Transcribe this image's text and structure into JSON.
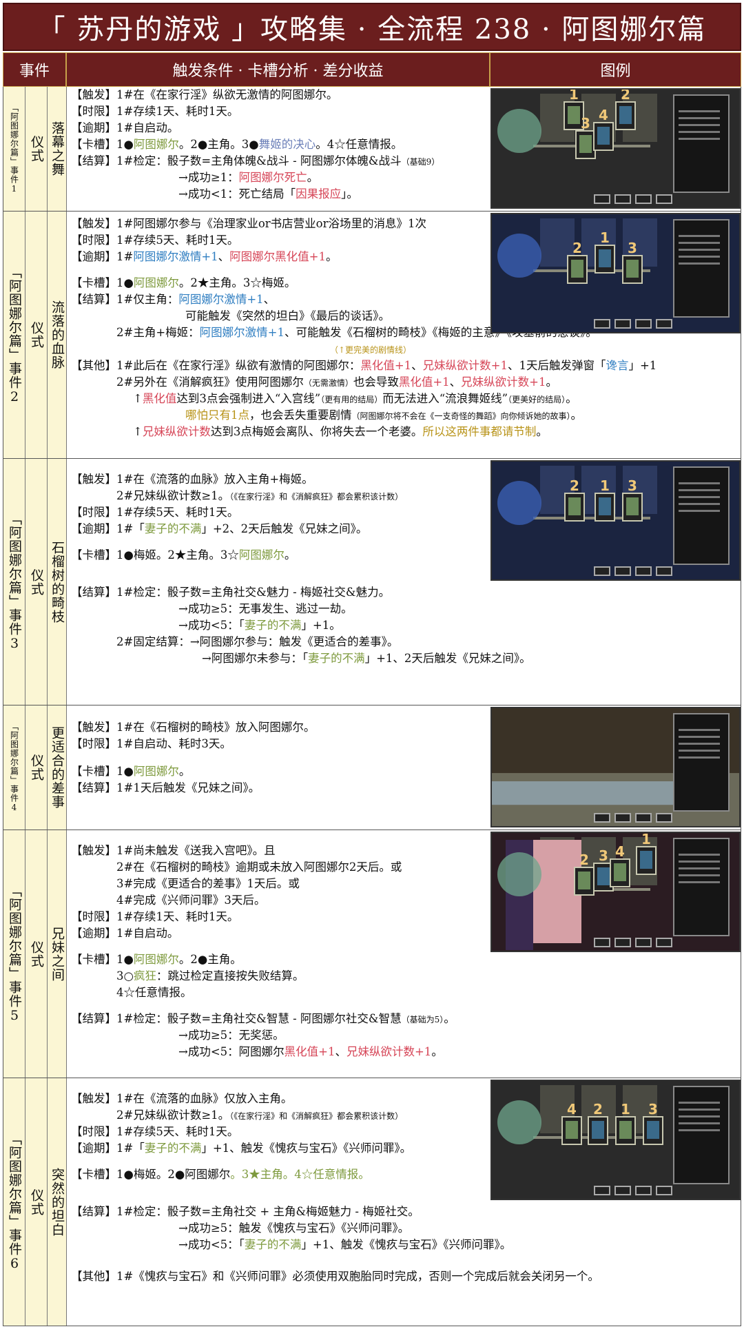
{
  "title": "「 苏丹的游戏 」攻略集 · 全流程 238 · 阿图娜尔篇",
  "headers": {
    "event": "事件",
    "desc": "触发条件 · 卡槽分析 · 差分收益",
    "image": "图例"
  },
  "rows": [
    {
      "chapter": "「阿图娜尔篇」事件1",
      "type": "仪式",
      "name": "落幕之舞",
      "lines": [
        [
          "【触发】1#在《在家行淫》纵欲无激情的阿图娜尔。"
        ],
        [
          "【时限】1#存续1天、耗时1天。"
        ],
        [
          "【逾期】1#自启动。"
        ],
        [
          "【卡槽】1●",
          "阿图娜尔",
          "。2●主角。3●",
          "舞姬的决心",
          "。4☆任意情报。"
        ],
        [
          "【结算】1#检定：骰子数=主角体魄&战斗 - 阿图娜尔体魄&战斗",
          "（基础9）"
        ],
        [
          "→成功≥1：",
          "阿图娜尔死亡",
          "。"
        ],
        [
          "→成功<1：死亡结局「",
          "因果报应",
          "」。"
        ]
      ],
      "slot_numbers": [
        "1",
        "2",
        "3",
        "4"
      ]
    },
    {
      "chapter": "「阿图娜尔篇」事件2",
      "type": "仪式",
      "name": "流落的血脉",
      "lines": [
        [
          "【触发】1#阿图娜尔参与《治理家业or书店营业or浴场里的消息》1次"
        ],
        [
          "【时限】1#存续5天、耗时1天。"
        ],
        [
          "【逾期】1#",
          "阿图娜尔激情+1",
          "、",
          "阿图娜尔黑化值+1",
          "。"
        ],
        [
          "【卡槽】1●",
          "阿图娜尔",
          "。2★主角。3☆梅姬。"
        ],
        [
          "【结算】1#仅主角：",
          "阿图娜尔激情+1",
          "、"
        ],
        [
          "可能触发《突然的坦白》《最后的谈话》。"
        ],
        [
          "2#主角+梅姬：",
          "阿图娜尔激情+1",
          "、可能触发《石榴树的畸枝》《梅姬的主意》《坟墓前的恳谈》。"
        ],
        [
          "（↑更完美的剧情线）"
        ],
        [
          "【其他】1#此后在《在家行淫》纵欲有激情的阿图娜尔：",
          "黑化值+1",
          "、",
          "兄妹纵欲计数+1",
          "、1天后触发弹窗「",
          "谗言",
          "」+1"
        ],
        [
          "2#另外在《消解疯狂》使用阿图娜尔",
          "（无需激情）",
          "也会导致",
          "黑化值+1",
          "、",
          "兄妹纵欲计数+1",
          "。"
        ],
        [
          "↑",
          "黑化值",
          "达到3点会强制进入“入宫线”",
          "（更有用的结局）",
          "而无法进入“流浪舞姬线”",
          "（更美好的结局）",
          "。"
        ],
        [
          "哪怕只有1点",
          "，也会丢失重要剧情",
          "（阿图娜尔将不会在《一支奇怪的舞蹈》向你倾诉她的故事）",
          "。"
        ],
        [
          "↑",
          "兄妹纵欲计数",
          "达到3点梅姬会离队、你将失去一个老婆。",
          "所以这两件事都请节制",
          "。"
        ]
      ],
      "slot_numbers": [
        "2",
        "1",
        "3"
      ]
    },
    {
      "chapter": "「阿图娜尔篇」事件3",
      "type": "仪式",
      "name": "石榴树的畸枝",
      "lines": [
        [
          "【触发】1#在《流落的血脉》放入主角+梅姬。"
        ],
        [
          "2#兄妹纵欲计数≥1。",
          "（《在家行淫》和《消解疯狂》都会累积该计数）"
        ],
        [
          "【时限】1#存续5天、耗时1天。"
        ],
        [
          "【逾期】1#「",
          "妻子的不满",
          "」+2、2天后触发《兄妹之间》。"
        ],
        [
          "【卡槽】1●梅姬。2★主角。3☆",
          "阿图娜尔",
          "。"
        ],
        [
          "【结算】1#检定：骰子数=主角社交&魅力 - 梅姬社交&魅力。"
        ],
        [
          "→成功≥5：无事发生、逃过一劫。"
        ],
        [
          "→成功<5：「",
          "妻子的不满",
          "」+1。"
        ],
        [
          "2#固定结算：→阿图娜尔参与：触发《更适合的差事》。"
        ],
        [
          "→阿图娜尔未参与：「",
          "妻子的不满",
          "」+1、2天后触发《兄妹之间》。"
        ]
      ],
      "slot_numbers": [
        "2",
        "1",
        "3"
      ]
    },
    {
      "chapter": "「阿图娜尔篇」事件4",
      "type": "仪式",
      "name": "更适合的差事",
      "lines": [
        [
          "【触发】1#在《石榴树的畸枝》放入阿图娜尔。"
        ],
        [
          "【时限】1#自启动、耗时3天。"
        ],
        [
          "【卡槽】1●",
          "阿图娜尔",
          "。"
        ],
        [
          "【结算】1#1天后触发《兄妹之间》。"
        ]
      ],
      "slot_numbers": []
    },
    {
      "chapter": "「阿图娜尔篇」事件5",
      "type": "仪式",
      "name": "兄妹之间",
      "lines": [
        [
          "【触发】1#尚未触发《送我入宫吧》。且"
        ],
        [
          "2#在《石榴树的畸枝》逾期或未放入阿图娜尔2天后。或"
        ],
        [
          "3#完成《更适合的差事》1天后。或"
        ],
        [
          "4#完成《兴师问罪》3天后。"
        ],
        [
          "【时限】1#存续1天、耗时1天。"
        ],
        [
          "【逾期】1#自启动。"
        ],
        [
          "【卡槽】1●",
          "阿图娜尔",
          "。2●主角。"
        ],
        [
          "3○",
          "疯狂",
          "：跳过检定直接按失败结算。"
        ],
        [
          "4☆任意情报。"
        ],
        [
          "【结算】1#检定：骰子数=主角社交&智慧 - 阿图娜尔社交&智慧",
          "（基础为5）",
          "。"
        ],
        [
          "→成功≥5：无奖惩。"
        ],
        [
          "→成功<5：阿图娜尔",
          "黑化值+1",
          "、",
          "兄妹纵欲计数+1",
          "。"
        ]
      ],
      "slot_numbers": [
        "2",
        "3",
        "4",
        "1"
      ]
    },
    {
      "chapter": "「阿图娜尔篇」事件6",
      "type": "仪式",
      "name": "突然的坦白",
      "lines": [
        [
          "【触发】1#在《流落的血脉》仅放入主角。"
        ],
        [
          "2#兄妹纵欲计数≥1。",
          "（《在家行淫》和《消解疯狂》都会累积该计数）"
        ],
        [
          "【时限】1#存续5天、耗时1天。"
        ],
        [
          "【逾期】1#「",
          "妻子的不满",
          "」+1、触发《愧疚与宝石》《兴师问罪》。"
        ],
        [
          "【卡槽】1●梅姬。2●",
          "阿图娜尔",
          "。3★主角。4☆任意情报。"
        ],
        [
          "【结算】1#检定：骰子数=主角社交 + 主角&梅姬魅力 - 梅姬社交。"
        ],
        [
          "→成功≥5：触发《愧疚与宝石》《兴师问罪》。"
        ],
        [
          "→成功<5：「",
          "妻子的不满",
          "」+1、触发《愧疚与宝石》《兴师问罪》。"
        ],
        [
          "【其他】1#《愧疚与宝石》和《兴师问罪》必须使用双胞胎同时完成，否则一个完成后就会关闭另一个。"
        ]
      ],
      "slot_numbers": [
        "4",
        "2",
        "1",
        "3"
      ]
    }
  ],
  "colors": {
    "header_bg": "#6b1e1e",
    "label_bg": "#fbf6d4",
    "green": "#7e9a3e",
    "red": "#d64557",
    "blue": "#2f7ec1",
    "gold": "#b89318"
  }
}
